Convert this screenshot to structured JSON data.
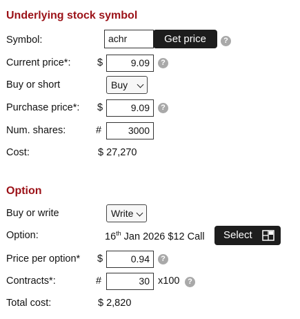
{
  "underlying": {
    "title": "Underlying stock symbol",
    "symbol_label": "Symbol:",
    "symbol_value": "achr",
    "get_price_label": "Get price",
    "current_price_label": "Current price*:",
    "current_price_currency": "$",
    "current_price_value": "9.09",
    "buy_short_label": "Buy or short",
    "buy_short_value": "Buy",
    "purchase_price_label": "Purchase price*:",
    "purchase_price_currency": "$",
    "purchase_price_value": "9.09",
    "num_shares_label": "Num. shares:",
    "num_shares_prefix": "#",
    "num_shares_value": "3000",
    "cost_label": "Cost:",
    "cost_value": "$ 27,270"
  },
  "option": {
    "title": "Option",
    "buy_write_label": "Buy or write",
    "buy_write_value": "Write",
    "option_label": "Option:",
    "option_day": "16",
    "option_day_suffix": "th",
    "option_rest": " Jan 2026 $12 Call",
    "select_label": "Select",
    "price_label": "Price per option*",
    "price_currency": "$",
    "price_value": "0.94",
    "contracts_label": "Contracts*:",
    "contracts_prefix": "#",
    "contracts_value": "30",
    "contracts_multiplier": "x100",
    "total_cost_label": "Total cost:",
    "total_cost_value": "$ 2,820"
  },
  "help_icon_glyph": "?",
  "accent_color": "#9b1117"
}
